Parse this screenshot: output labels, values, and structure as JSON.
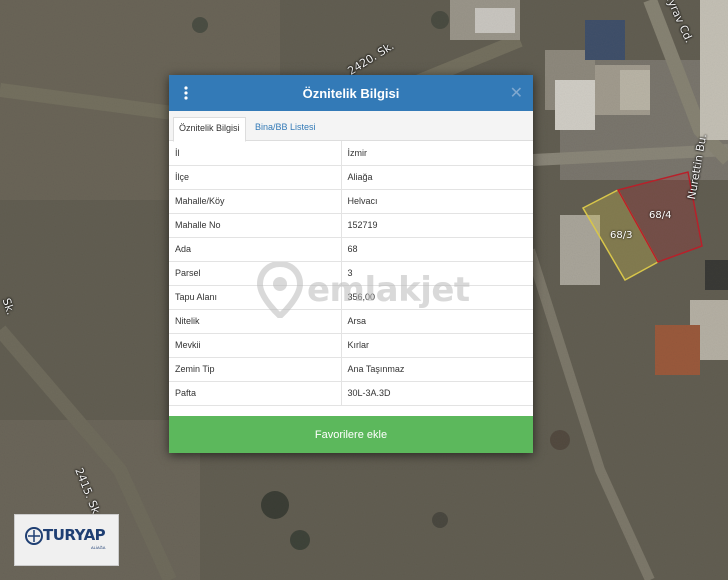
{
  "map": {
    "road_labels": [
      "2420. Sk.",
      "2415. Sk.",
      "Nurettin Bu.",
      "...yrav Cd.",
      "Sk."
    ],
    "parcels": [
      "68/3",
      "68/4"
    ],
    "colors": {
      "parcel_yellow": "#d8c64a",
      "parcel_red": "#b8202a"
    }
  },
  "dialog": {
    "title": "Öznitelik Bilgisi",
    "menu_icon": "vertical-dots-icon",
    "close_icon": "close-icon",
    "header_color": "#337ab7",
    "tabs": [
      {
        "label": "Öznitelik Bilgisi",
        "active": true
      },
      {
        "label": "Bina/BB Listesi",
        "active": false
      }
    ],
    "rows": [
      {
        "key": "İl",
        "value": "İzmir"
      },
      {
        "key": "İlçe",
        "value": "Aliağa"
      },
      {
        "key": "Mahalle/Köy",
        "value": "Helvacı"
      },
      {
        "key": "Mahalle No",
        "value": "152719"
      },
      {
        "key": "Ada",
        "value": "68"
      },
      {
        "key": "Parsel",
        "value": "3"
      },
      {
        "key": "Tapu Alanı",
        "value": "356,00"
      },
      {
        "key": "Nitelik",
        "value": "Arsa"
      },
      {
        "key": "Mevkii",
        "value": "Kırlar"
      },
      {
        "key": "Zemin Tip",
        "value": "Ana Taşınmaz"
      },
      {
        "key": "Pafta",
        "value": "30L-3A.3D"
      }
    ],
    "favorite_button": "Favorilere ekle",
    "button_color": "#5cb85c"
  },
  "watermark": {
    "text": "emlakjet",
    "icon": "location-pin-icon"
  },
  "logo": {
    "text": "TURYAP",
    "subtext": "ALİAĞA",
    "icon": "turyap-logo-icon"
  }
}
